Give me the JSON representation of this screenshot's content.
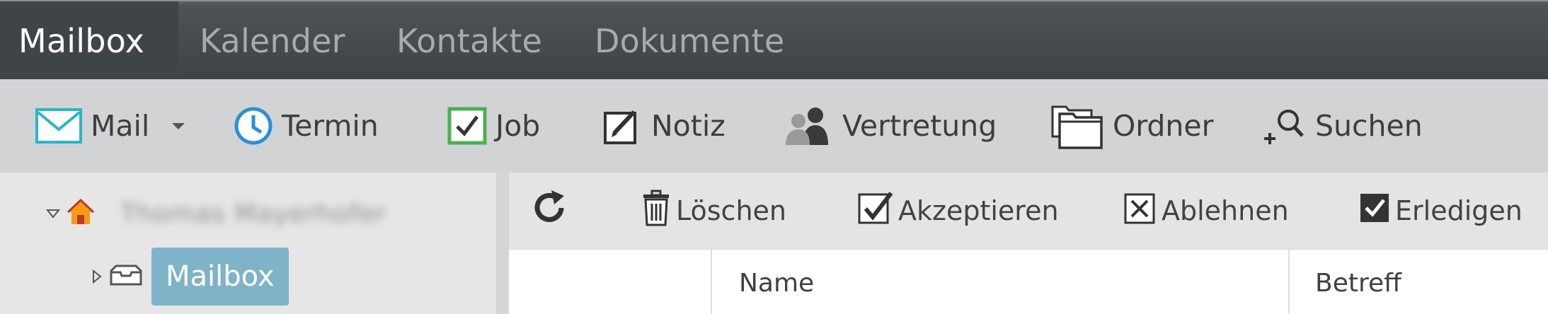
{
  "tabs": [
    {
      "label": "Mailbox",
      "active": true
    },
    {
      "label": "Kalender",
      "active": false
    },
    {
      "label": "Kontakte",
      "active": false
    },
    {
      "label": "Dokumente",
      "active": false
    }
  ],
  "toolbar": {
    "mail": {
      "label": "Mail",
      "icon": "envelope-icon"
    },
    "termin": {
      "label": "Termin",
      "icon": "clock-icon"
    },
    "job": {
      "label": "Job",
      "icon": "checkbox-icon"
    },
    "notiz": {
      "label": "Notiz",
      "icon": "note-pencil-icon"
    },
    "vertretung": {
      "label": "Vertretung",
      "icon": "people-icon"
    },
    "ordner": {
      "label": "Ordner",
      "icon": "folders-icon"
    },
    "suchen": {
      "label": "Suchen",
      "icon": "search-plus-icon"
    }
  },
  "tree": {
    "root_user": "Thomas Mayerhofer",
    "child_label": "Mailbox"
  },
  "actions": {
    "refresh_icon": "refresh-icon",
    "loeschen": "Löschen",
    "akzeptieren": "Akzeptieren",
    "ablehnen": "Ablehnen",
    "erledigen": "Erledigen"
  },
  "columns": {
    "name": "Name",
    "betreff": "Betreff"
  },
  "colors": {
    "topbar": "#464b50",
    "active_tab": "#3f4449",
    "toolbar": "#d2d3d4",
    "selection": "#7fb3c7",
    "mail_accent": "#29b6c8",
    "clock_accent": "#2b8fd6",
    "job_accent": "#4caf50",
    "home_accent": "#f39c12"
  }
}
